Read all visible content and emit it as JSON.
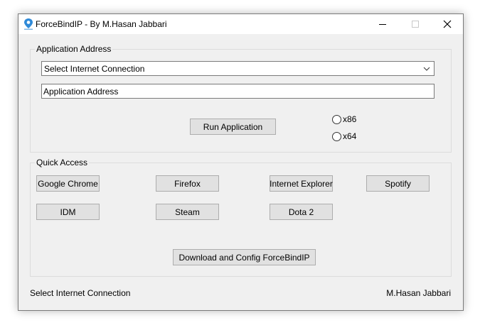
{
  "window": {
    "title": "ForceBindIP - By M.Hasan Jabbari",
    "icon": "app-pin-icon",
    "controls": [
      "minimize-icon",
      "maximize-icon",
      "close-icon"
    ]
  },
  "application_group": {
    "label": "Application Address",
    "connection_select": {
      "value": "Select Internet Connection"
    },
    "address_field": {
      "value": "Application Address"
    },
    "run_button": "Run Application",
    "arch": [
      {
        "label": "x86",
        "checked": false
      },
      {
        "label": "x64",
        "checked": false
      }
    ]
  },
  "quick_access": {
    "label": "Quick Access",
    "buttons": [
      "Google Chrome",
      "Firefox",
      "Internet Explorer",
      "Spotify",
      "IDM",
      "Steam",
      "Dota 2"
    ],
    "download_button": "Download and Config ForceBindIP"
  },
  "status_bar": {
    "left": "Select Internet Connection",
    "right": "M.Hasan Jabbari"
  },
  "colors": {
    "window_bg": "#f0f0f0",
    "button_bg": "#e1e1e1",
    "button_border": "#adadad",
    "accent": "#2f8ad8"
  }
}
